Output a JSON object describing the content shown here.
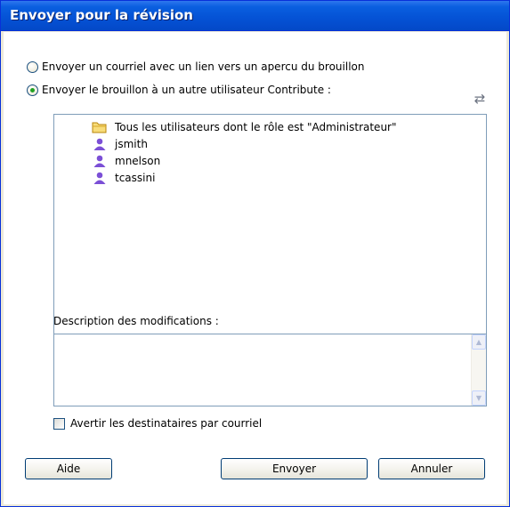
{
  "window": {
    "title": "Envoyer pour la révision"
  },
  "options": {
    "email_preview": {
      "label": "Envoyer un courriel avec un lien vers un apercu du brouillon",
      "selected": false
    },
    "send_to_user": {
      "label": "Envoyer le brouillon à un autre utilisateur Contribute :",
      "selected": true
    }
  },
  "recipients": {
    "items": [
      {
        "icon": "folder-icon",
        "label": "Tous les utilisateurs dont le rôle est \"Administrateur\""
      },
      {
        "icon": "user-icon",
        "label": "jsmith"
      },
      {
        "icon": "user-icon",
        "label": "mnelson"
      },
      {
        "icon": "user-icon",
        "label": "tcassini"
      }
    ]
  },
  "description": {
    "label": "Description des modifications :",
    "value": ""
  },
  "notify": {
    "label": "Avertir les destinataires par courriel",
    "checked": false
  },
  "buttons": {
    "help": "Aide",
    "send": "Envoyer",
    "cancel": "Annuler"
  },
  "colors": {
    "titlebar": "#0553d6",
    "radio_dot": "#21a121",
    "user_icon": "#7b4fd6",
    "folder_icon": "#f2c64b"
  }
}
